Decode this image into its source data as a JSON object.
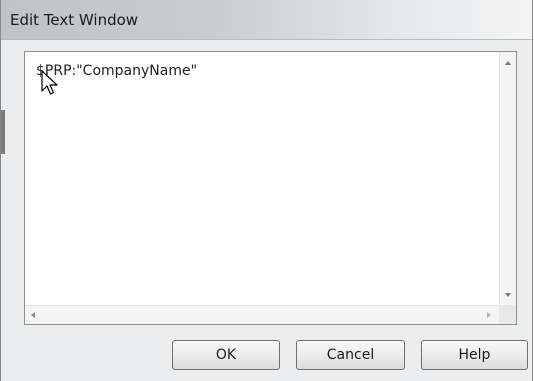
{
  "window": {
    "title": "Edit Text Window"
  },
  "editor": {
    "text": "$PRP:\"CompanyName\""
  },
  "buttons": {
    "ok": "OK",
    "cancel": "Cancel",
    "help": "Help"
  }
}
